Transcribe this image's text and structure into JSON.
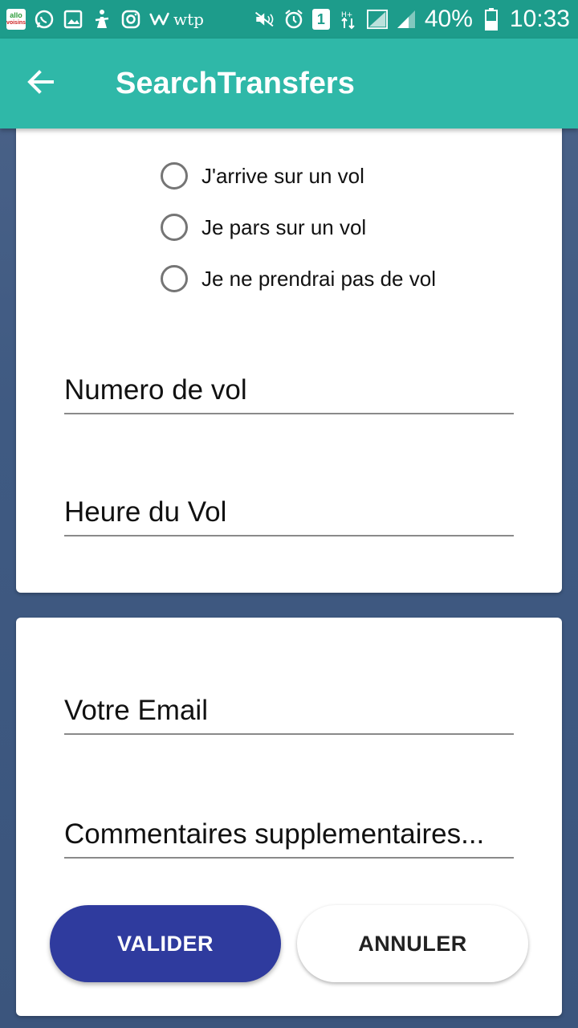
{
  "status_bar": {
    "notification_icons": [
      "allo-voisins-icon",
      "whatsapp-icon",
      "gallery-icon",
      "app-icon",
      "instagram-icon",
      "w-app-icon",
      "wtp-icon"
    ],
    "allo_line1": "allo",
    "allo_line2": "voisins",
    "wtp_text": "wtp",
    "sim_slot": "1",
    "battery": "40%",
    "time": "10:33"
  },
  "app_bar": {
    "title": "SearchTransfers",
    "back_icon": "arrow-back-icon"
  },
  "flight_options": [
    {
      "label": "J'arrive sur un vol",
      "selected": false
    },
    {
      "label": "Je pars sur un vol",
      "selected": false
    },
    {
      "label": "Je ne prendrai pas de vol",
      "selected": false
    }
  ],
  "fields": {
    "flight_number": "Numero de vol",
    "flight_time": "Heure du Vol",
    "email": "Votre Email",
    "comments": "Commentaires supplementaires..."
  },
  "buttons": {
    "validate": "VALIDER",
    "cancel": "ANNULER"
  },
  "colors": {
    "status_bar": "#1d9c8b",
    "app_bar": "#2fb8a8",
    "primary_button": "#2f3b9e",
    "background": "#44608a"
  }
}
